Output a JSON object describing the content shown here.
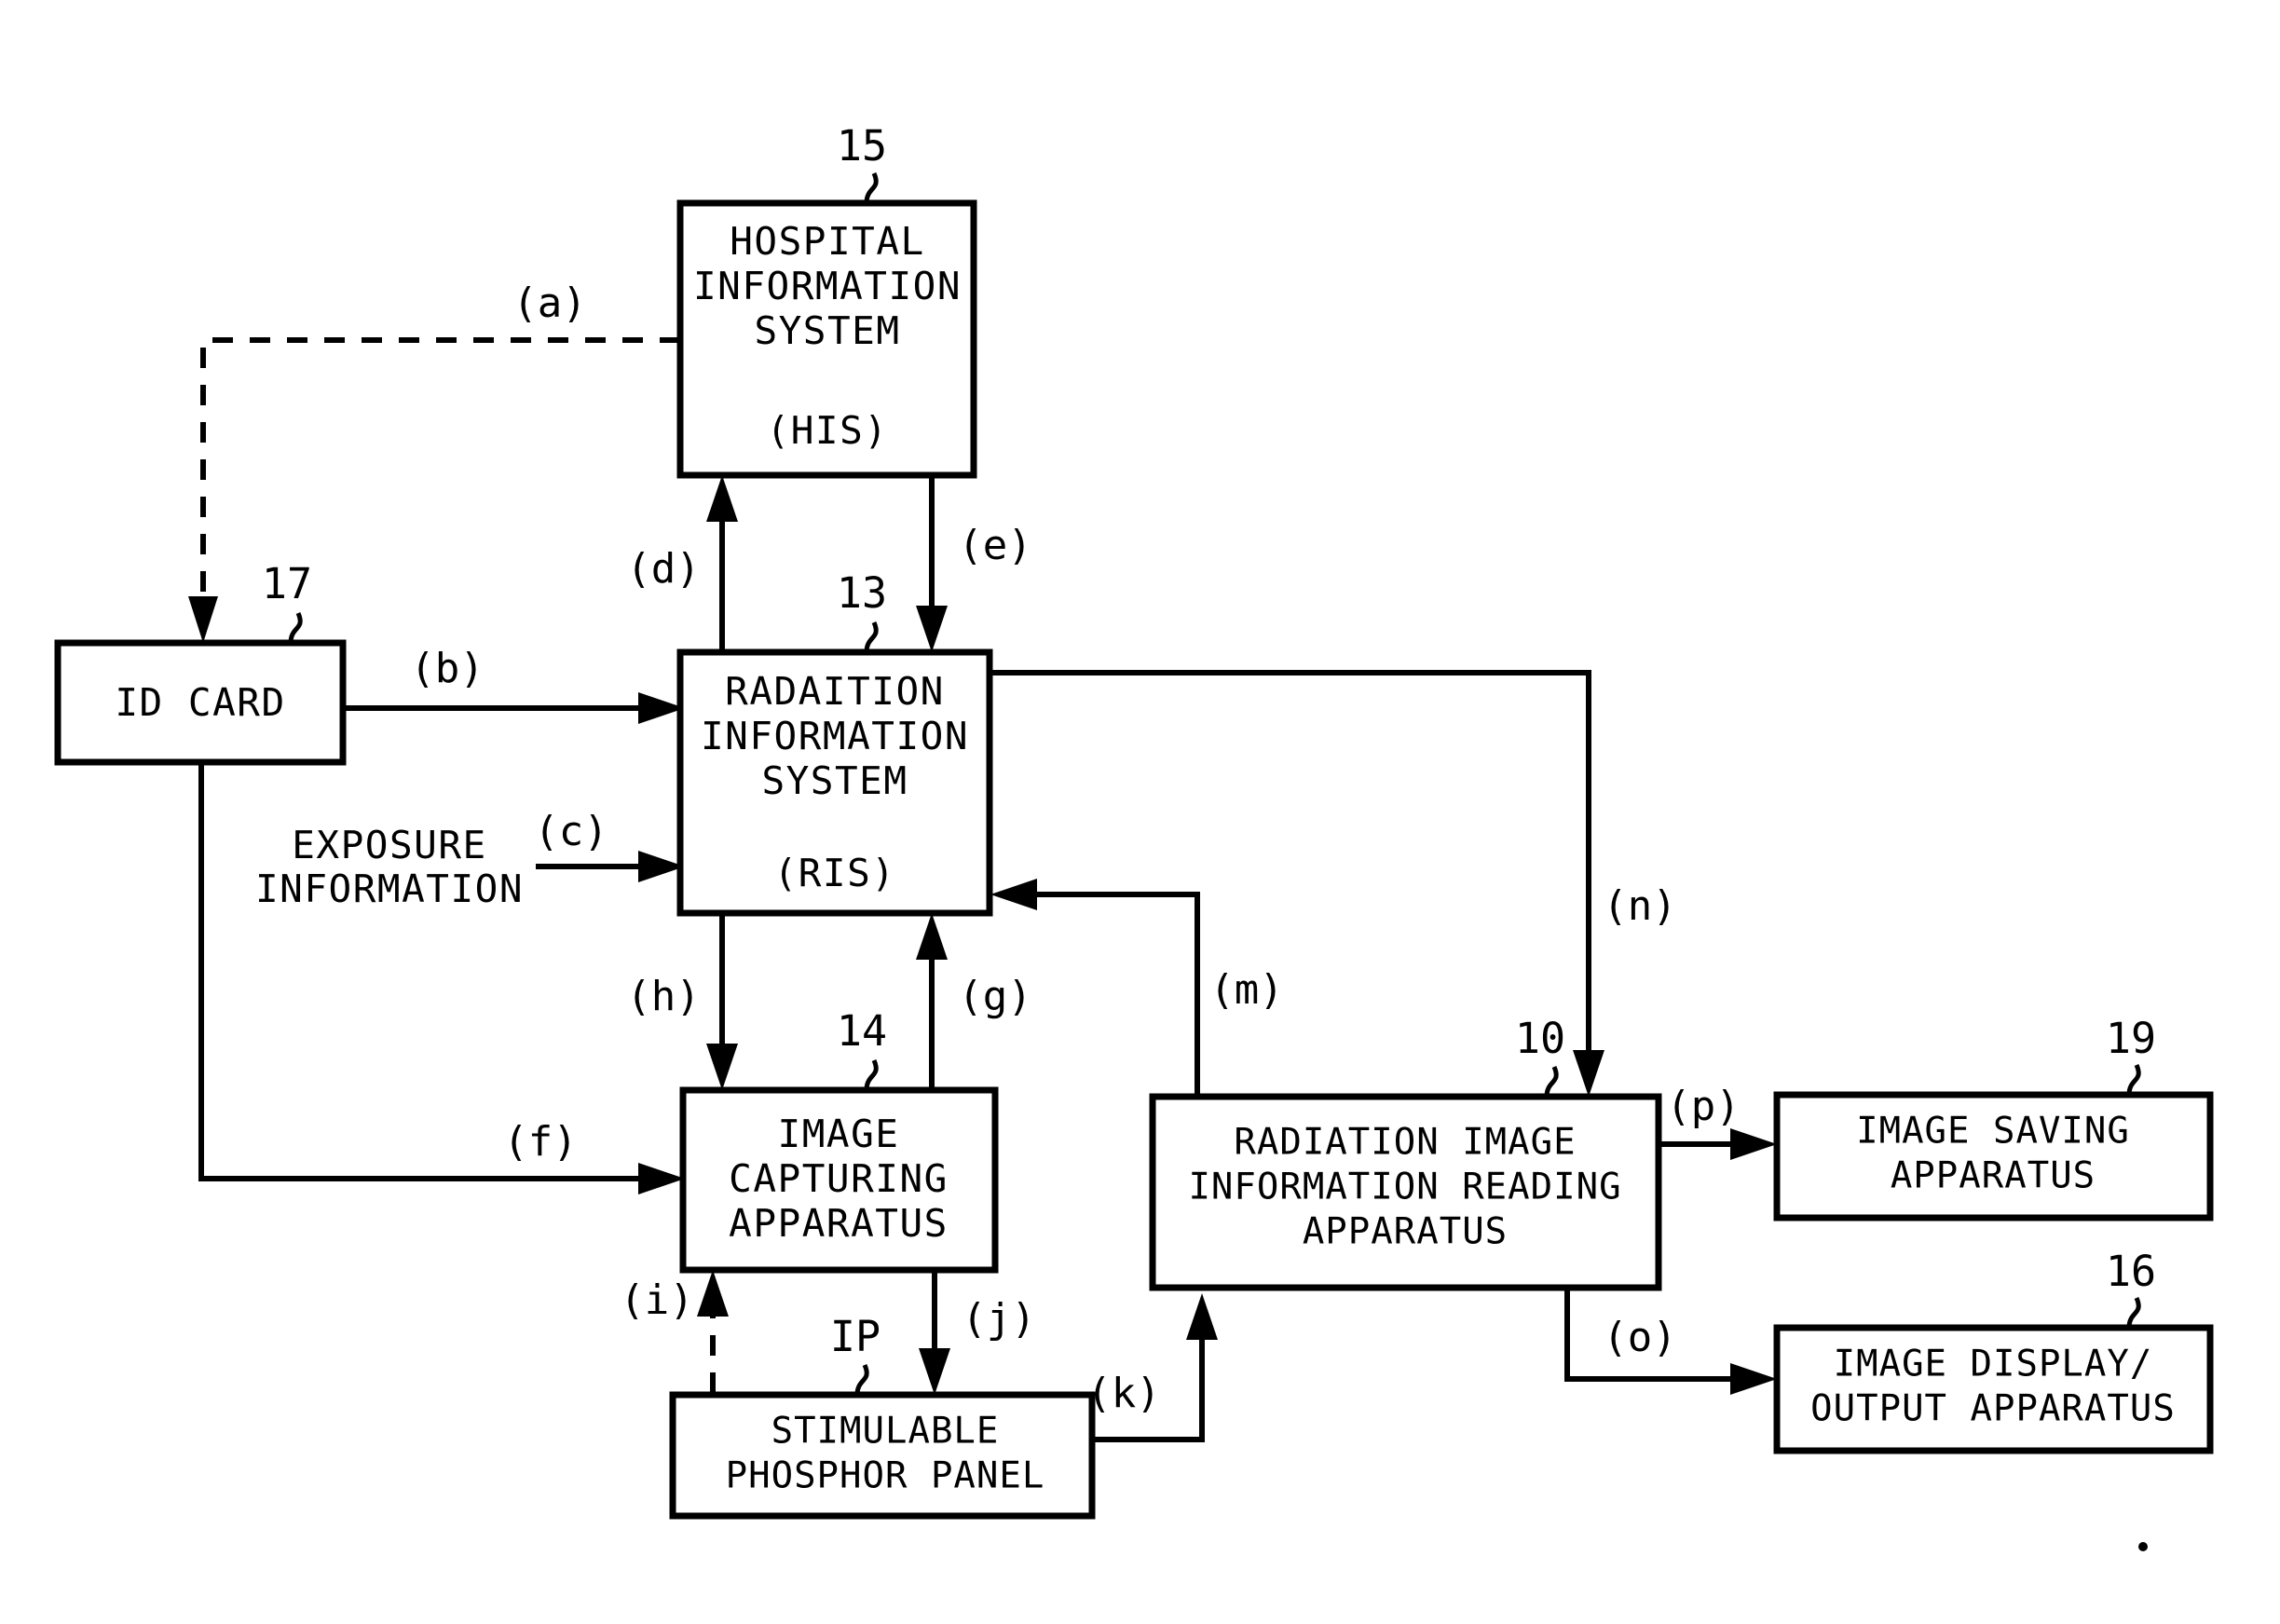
{
  "figure": {
    "type": "block-diagram",
    "title": "Radiation image information reading system block diagram",
    "background_color": "#ffffff",
    "line_color": "#000000"
  },
  "boxes": {
    "his": {
      "ref": "15",
      "lines": [
        "HOSPITAL",
        "INFORMATION",
        "SYSTEM"
      ],
      "abbrev": "(HIS)",
      "line1": "HOSPITAL",
      "line2": "INFORMATION",
      "line3": "SYSTEM"
    },
    "ris": {
      "ref": "13",
      "lines": [
        "RADAITION",
        "INFORMATION",
        "SYSTEM"
      ],
      "abbrev": "(RIS)",
      "line1": "RADAITION",
      "line2": "INFORMATION",
      "line3": "SYSTEM"
    },
    "id_card": {
      "ref": "17",
      "line1": "ID CARD"
    },
    "image_capturing": {
      "ref": "14",
      "line1": "IMAGE",
      "line2": "CAPTURING",
      "line3": "APPARATUS"
    },
    "reading_apparatus": {
      "ref": "10",
      "line1": "RADIATION IMAGE",
      "line2": "INFORMATION READING",
      "line3": "APPARATUS"
    },
    "image_saving": {
      "ref": "19",
      "line1": "IMAGE SAVING",
      "line2": "APPARATUS"
    },
    "image_display": {
      "ref": "16",
      "line1": "IMAGE DISPLAY/",
      "line2": "OUTPUT APPARATUS"
    },
    "phosphor_panel": {
      "ref": "IP",
      "line1": "STIMULABLE",
      "line2": "PHOSPHOR PANEL"
    }
  },
  "free_labels": {
    "exposure_info_line1": "EXPOSURE",
    "exposure_info_line2": "INFORMATION"
  },
  "edge_labels": {
    "a": "(a)",
    "b": "(b)",
    "c": "(c)",
    "d": "(d)",
    "e": "(e)",
    "f": "(f)",
    "g": "(g)",
    "h": "(h)",
    "i": "(i)",
    "j": "(j)",
    "k": "(k)",
    "m": "(m)",
    "n": "(n)",
    "o": "(o)",
    "p": "(p)"
  }
}
